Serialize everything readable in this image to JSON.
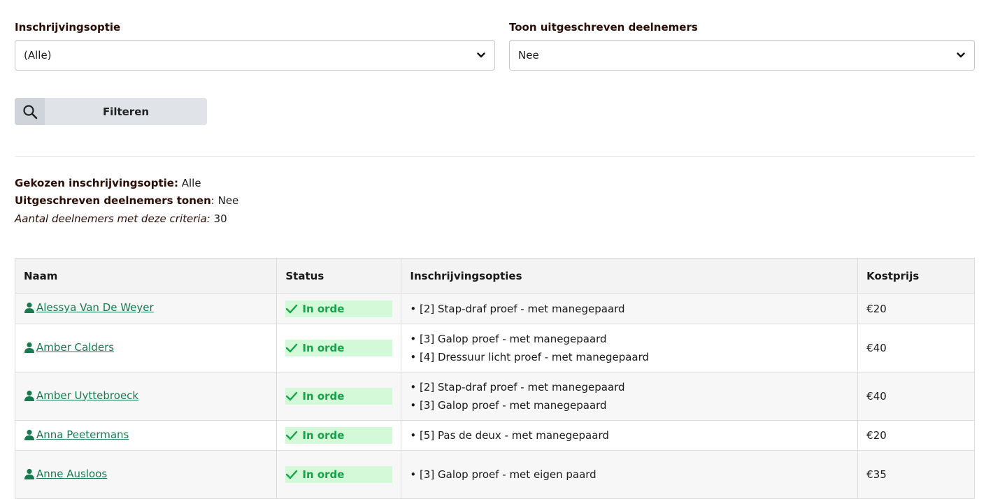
{
  "filters": {
    "option_label": "Inschrijvingsoptie",
    "option_value": "(Alle)",
    "show_label": "Toon uitgeschreven deelnemers",
    "show_value": "Nee",
    "button_label": "Filteren"
  },
  "summary": {
    "chosen_label": "Gekozen inschrijvingsoptie:",
    "chosen_value": "Alle",
    "show_label": "Uitgeschreven deelnemers tonen",
    "show_value": "Nee",
    "count_label": "Aantal deelnemers met deze criteria:",
    "count_value": "30"
  },
  "table": {
    "headers": [
      "Naam",
      "Status",
      "Inschrijvingsopties",
      "Kostprijs"
    ],
    "rows": [
      {
        "name": "Alessya Van De Weyer",
        "status": "In orde",
        "options": [
          "• [2] Stap-draf proef - met manegepaard"
        ],
        "price": "€20"
      },
      {
        "name": "Amber Calders",
        "status": "In orde",
        "options": [
          "• [3] Galop proef - met manegepaard",
          "• [4] Dressuur licht proef - met manegepaard"
        ],
        "price": "€40"
      },
      {
        "name": "Amber Uyttebroeck",
        "status": "In orde",
        "options": [
          "• [2] Stap-draf proef - met manegepaard",
          "• [3] Galop proef - met manegepaard"
        ],
        "price": "€40"
      },
      {
        "name": "Anna Peetermans",
        "status": "In orde",
        "options": [
          "• [5] Pas de deux - met manegepaard"
        ],
        "price": "€20"
      },
      {
        "name": "Anne Ausloos",
        "status": "In orde",
        "options": [
          "• [3] Galop proef - met eigen paard",
          ""
        ],
        "price": "€35"
      }
    ]
  },
  "colors": {
    "link": "#1a7a4f",
    "status_bg": "#d3f9d8",
    "status_text": "#16a34a"
  }
}
